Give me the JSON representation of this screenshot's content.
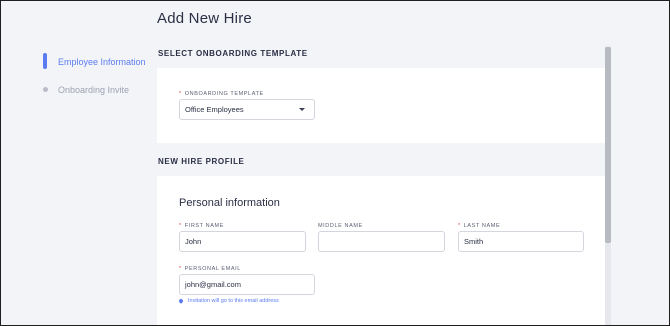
{
  "page": {
    "title": "Add New Hire"
  },
  "steps": [
    {
      "label": "Employee Information",
      "state": "active"
    },
    {
      "label": "Onboarding Invite",
      "state": "inactive"
    }
  ],
  "template_section": {
    "heading": "SELECT ONBOARDING TEMPLATE",
    "field_label": "ONBOARDING TEMPLATE",
    "required_mark": "*",
    "selected_value": "Office Employees"
  },
  "profile_section": {
    "heading": "NEW HIRE PROFILE",
    "card_title": "Personal information",
    "fields": {
      "first_name": {
        "label": "FIRST NAME",
        "value": "John"
      },
      "middle_name": {
        "label": "MIDDLE NAME",
        "value": ""
      },
      "last_name": {
        "label": "LAST NAME",
        "value": "Smith"
      },
      "personal_email": {
        "label": "PERSONAL EMAIL",
        "value": "john@gmail.com"
      }
    },
    "email_hint": "Invitation will go to this email address"
  },
  "colors": {
    "accent": "#5b7cf0",
    "required": "#e0413d",
    "background": "#f3f4f8"
  }
}
